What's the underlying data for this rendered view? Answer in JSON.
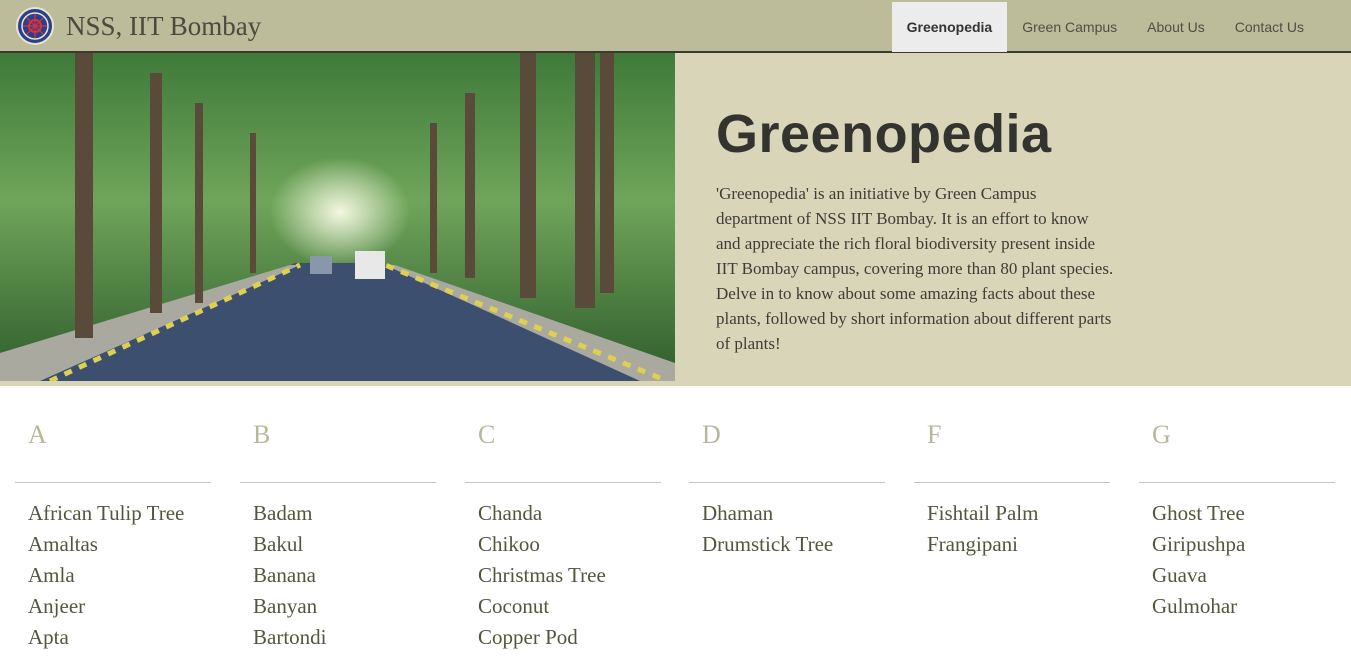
{
  "navbar": {
    "brand": "NSS, IIT Bombay",
    "items": [
      {
        "label": "Greenopedia",
        "active": true
      },
      {
        "label": "Green Campus",
        "active": false
      },
      {
        "label": "About Us",
        "active": false
      },
      {
        "label": "Contact Us",
        "active": false
      }
    ]
  },
  "hero": {
    "title": "Greenopedia",
    "description": "'Greenopedia' is an initiative by Green Campus department of NSS IIT Bombay. It is an effort to know and appreciate the rich floral biodiversity present inside IIT Bombay campus, covering more than 80 plant species. Delve in to know about some amazing facts about these plants, followed by short information about different parts of plants!"
  },
  "index": {
    "columns": [
      {
        "letter": "A",
        "items": [
          "African Tulip Tree",
          "Amaltas",
          "Amla",
          "Anjeer",
          "Apta"
        ]
      },
      {
        "letter": "B",
        "items": [
          "Badam",
          "Bakul",
          "Banana",
          "Banyan",
          "Bartondi"
        ]
      },
      {
        "letter": "C",
        "items": [
          "Chanda",
          "Chikoo",
          "Christmas Tree",
          "Coconut",
          "Copper Pod"
        ]
      },
      {
        "letter": "D",
        "items": [
          "Dhaman",
          "Drumstick Tree"
        ]
      },
      {
        "letter": "F",
        "items": [
          "Fishtail Palm",
          "Frangipani"
        ]
      },
      {
        "letter": "G",
        "items": [
          "Ghost Tree",
          "Giripushpa",
          "Guava",
          "Gulmohar"
        ]
      }
    ]
  },
  "colors": {
    "navbar_bg": "#bcbb9a",
    "hero_bg": "#d9d5b8",
    "letter": "#b8b79a",
    "item_text": "#55553f"
  }
}
